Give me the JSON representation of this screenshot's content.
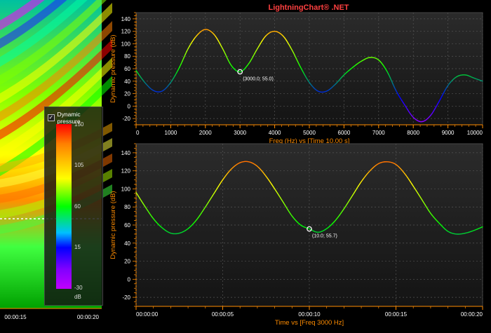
{
  "app": {
    "title": "LightningChart® .NET",
    "title_color": "#ff4040"
  },
  "heatmap": {
    "time_labels": [
      "00:00:15",
      "00:00:20"
    ],
    "legend": {
      "title": "Dynamic pressure",
      "checked": true,
      "ticks": [
        "150",
        "105",
        "60",
        "15",
        "-30"
      ],
      "unit": "dB"
    }
  },
  "chart_data": [
    {
      "type": "line",
      "title": "",
      "xlabel": "Freq (Hz) vs [Time 10.00 s]",
      "ylabel": "Dynamic pressure (dB)",
      "xlim": [
        0,
        10000
      ],
      "ylim": [
        -30,
        150
      ],
      "x_ticks": [
        "0",
        "1000",
        "2000",
        "3000",
        "4000",
        "5000",
        "6000",
        "7000",
        "8000",
        "9000",
        "10000"
      ],
      "y_ticks": [
        "140",
        "120",
        "100",
        "80",
        "60",
        "40",
        "20",
        "0",
        "-20"
      ],
      "grid": true,
      "series": [
        {
          "x": [
            0,
            250,
            500,
            750,
            1000,
            1250,
            1500,
            1750,
            2000,
            2250,
            2500,
            2750,
            3000,
            3250,
            3500,
            3750,
            4000,
            4250,
            4500,
            4750,
            5000,
            5250,
            5500,
            5750,
            6000,
            6250,
            6500,
            6750,
            7000,
            7250,
            7500,
            7750,
            8000,
            8250,
            8500,
            8750,
            9000,
            9250,
            9500,
            9750,
            10000
          ],
          "values": [
            57,
            38,
            25,
            24,
            38,
            62,
            92,
            113,
            123,
            115,
            92,
            65,
            55,
            68,
            92,
            113,
            120,
            112,
            90,
            62,
            38,
            24,
            24,
            35,
            50,
            62,
            72,
            78,
            74,
            55,
            25,
            2,
            -18,
            -25,
            -15,
            8,
            33,
            47,
            50,
            45,
            40
          ]
        }
      ],
      "cursor": {
        "x": 3000,
        "y": 55,
        "label": "(3000.0; 55.0)"
      }
    },
    {
      "type": "line",
      "title": "",
      "xlabel": "Time vs [Freq 3000 Hz]",
      "ylabel": "Dynamic pressure (dB)",
      "xlim": [
        0,
        20
      ],
      "ylim": [
        -30,
        150
      ],
      "x_ticks": [
        "00:00:00",
        "00:00:05",
        "00:00:10",
        "00:00:15",
        "00:00:20"
      ],
      "y_ticks": [
        "140",
        "120",
        "100",
        "80",
        "60",
        "40",
        "20",
        "0",
        "-20"
      ],
      "grid": true,
      "series": [
        {
          "x": [
            0,
            0.5,
            1,
            1.5,
            2,
            2.5,
            3,
            3.5,
            4,
            4.5,
            5,
            5.5,
            6,
            6.5,
            7,
            7.5,
            8,
            8.5,
            9,
            9.5,
            10,
            10.5,
            11,
            11.5,
            12,
            12.5,
            13,
            13.5,
            14,
            14.5,
            15,
            15.5,
            16,
            16.5,
            17,
            17.5,
            18,
            18.5,
            19,
            19.5,
            20
          ],
          "values": [
            96,
            81,
            67,
            57,
            51,
            51,
            56,
            66,
            80,
            95,
            110,
            122,
            129,
            130,
            125,
            114,
            100,
            85,
            70,
            60,
            55.7,
            52,
            56,
            65,
            78,
            93,
            108,
            120,
            128,
            130,
            127,
            117,
            103,
            88,
            73,
            62,
            53,
            50,
            51,
            54,
            58
          ]
        }
      ],
      "cursor": {
        "x": 10,
        "y": 55.7,
        "label": "(10.0; 55.7)"
      }
    }
  ],
  "colors": {
    "axis_tick": "#ff8c00",
    "axis_label": "#ff8c00",
    "tick_text": "#ffffff",
    "plot_bg_top": "#2b2b2b",
    "plot_bg_bottom": "#151515",
    "grid": "#555555",
    "cursor": "#ffffff"
  }
}
